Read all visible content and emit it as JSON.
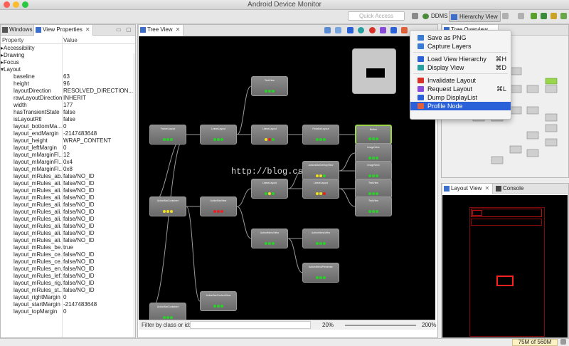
{
  "window": {
    "title": "Android Device Monitor"
  },
  "toolbar": {
    "quick_access_placeholder": "Quick Access",
    "perspectives": [
      {
        "label": "DDMS"
      },
      {
        "label": "Hierarchy View"
      }
    ]
  },
  "left_panel": {
    "tabs": [
      {
        "label": "Windows"
      },
      {
        "label": "View Properties"
      }
    ],
    "columns": {
      "property": "Property",
      "value": "Value"
    },
    "rows": [
      {
        "name": "Accessibility",
        "value": "",
        "group": true,
        "expanded": false
      },
      {
        "name": "Drawing",
        "value": "",
        "group": true,
        "expanded": false
      },
      {
        "name": "Focus",
        "value": "",
        "group": true,
        "expanded": false
      },
      {
        "name": "Layout",
        "value": "",
        "group": true,
        "expanded": true
      },
      {
        "name": "baseline",
        "value": "63"
      },
      {
        "name": "height",
        "value": "96"
      },
      {
        "name": "layoutDirection",
        "value": "RESOLVED_DIRECTION..."
      },
      {
        "name": "rawLayoutDirection",
        "value": "INHERIT"
      },
      {
        "name": "width",
        "value": "177"
      },
      {
        "name": "hasTransientState",
        "value": "false"
      },
      {
        "name": "isLayoutRtl",
        "value": "false"
      },
      {
        "name": "layout_bottomMa...",
        "value": "0"
      },
      {
        "name": "layout_endMargin",
        "value": "-2147483648"
      },
      {
        "name": "layout_height",
        "value": "WRAP_CONTENT"
      },
      {
        "name": "layout_leftMargin",
        "value": "0"
      },
      {
        "name": "layout_mMarginFl...",
        "value": "12"
      },
      {
        "name": "layout_mMarginFl...",
        "value": "0x4"
      },
      {
        "name": "layout_mMarginFl...",
        "value": "0x8"
      },
      {
        "name": "layout_mRules_ab...",
        "value": "false/NO_ID"
      },
      {
        "name": "layout_mRules_ali...",
        "value": "false/NO_ID"
      },
      {
        "name": "layout_mRules_ali...",
        "value": "false/NO_ID"
      },
      {
        "name": "layout_mRules_ali...",
        "value": "false/NO_ID"
      },
      {
        "name": "layout_mRules_ali...",
        "value": "false/NO_ID"
      },
      {
        "name": "layout_mRules_ali...",
        "value": "false/NO_ID"
      },
      {
        "name": "layout_mRules_ali...",
        "value": "false/NO_ID"
      },
      {
        "name": "layout_mRules_ali...",
        "value": "false/NO_ID"
      },
      {
        "name": "layout_mRules_ali...",
        "value": "false/NO_ID"
      },
      {
        "name": "layout_mRules_ali...",
        "value": "false/NO_ID"
      },
      {
        "name": "layout_mRules_be...",
        "value": "true"
      },
      {
        "name": "layout_mRules_ce...",
        "value": "false/NO_ID"
      },
      {
        "name": "layout_mRules_ce...",
        "value": "false/NO_ID"
      },
      {
        "name": "layout_mRules_en...",
        "value": "false/NO_ID"
      },
      {
        "name": "layout_mRules_lef...",
        "value": "false/NO_ID"
      },
      {
        "name": "layout_mRules_rig...",
        "value": "false/NO_ID"
      },
      {
        "name": "layout_mRules_st...",
        "value": "false/NO_ID"
      },
      {
        "name": "layout_rightMargin",
        "value": "0"
      },
      {
        "name": "layout_startMargin",
        "value": "-2147483648"
      },
      {
        "name": "layout_topMargin",
        "value": "0"
      }
    ]
  },
  "tree_view": {
    "tab_label": "Tree View",
    "filter_placeholder": "Filter by class or id:",
    "zoom_min": "20%",
    "zoom_max": "200%",
    "watermark": "http://blog.csdn.net/",
    "nodes": [
      {
        "title": "FrameLayout",
        "lights": [
          "green",
          "green",
          "green"
        ],
        "selected": false
      },
      {
        "title": "LinearLayout",
        "lights": [
          "green",
          "green",
          "green"
        ],
        "selected": false
      },
      {
        "title": "TextView",
        "lights": [
          "green",
          "green",
          "green"
        ],
        "selected": false
      },
      {
        "title": "LinearLayout",
        "lights": [
          "yellow",
          "red",
          "green"
        ],
        "selected": false
      },
      {
        "title": "RelativeLayout",
        "lights": [
          "green",
          "green",
          "green"
        ],
        "selected": false
      },
      {
        "title": "Button",
        "lights": [
          "green",
          "green",
          "green"
        ],
        "selected": true
      },
      {
        "title": "ActionBarContainer",
        "lights": [
          "yellow",
          "yellow",
          "yellow"
        ],
        "selected": false
      },
      {
        "title": "ActionBarView",
        "lights": [
          "red",
          "red",
          "red"
        ],
        "selected": false
      },
      {
        "title": "LinearLayout",
        "lights": [
          "green",
          "yellow",
          "green"
        ],
        "selected": false
      },
      {
        "title": "ActionBarOverlayView",
        "lights": [
          "yellow",
          "yellow",
          "green"
        ],
        "selected": false
      },
      {
        "title": "ImageView",
        "lights": [
          "green",
          "green",
          "green"
        ],
        "selected": false
      },
      {
        "title": "ImageView",
        "lights": [
          "green",
          "green",
          "green"
        ],
        "selected": false
      },
      {
        "title": "LinearLayout",
        "lights": [
          "yellow",
          "yellow",
          "red"
        ],
        "selected": false
      },
      {
        "title": "TextView",
        "lights": [
          "green",
          "green",
          "green"
        ],
        "selected": false
      },
      {
        "title": "TextView",
        "lights": [
          "green",
          "green",
          "green"
        ],
        "selected": false
      },
      {
        "title": "ActionMenuView",
        "lights": [
          "green",
          "green",
          "green"
        ],
        "selected": false
      },
      {
        "title": "ActionMenuView",
        "lights": [
          "green",
          "green",
          "green"
        ],
        "selected": false
      },
      {
        "title": "ActionMenuPresenter",
        "lights": [
          "green",
          "green",
          "green"
        ],
        "selected": false
      },
      {
        "title": "ActionBarContextView",
        "lights": [
          "green",
          "green",
          "green"
        ],
        "selected": false
      },
      {
        "title": "ActionBarContainer",
        "lights": [
          "green",
          "green",
          "green"
        ],
        "selected": false
      }
    ]
  },
  "overview_panel": {
    "tab_label": "Tree Overview"
  },
  "layout_panel": {
    "tabs": [
      {
        "label": "Layout View"
      },
      {
        "label": "Console"
      }
    ]
  },
  "context_menu": {
    "items": [
      {
        "label": "Save as PNG",
        "shortcut": "",
        "icon": "save-icon",
        "color": "#3a7bd5",
        "highlighted": false
      },
      {
        "label": "Capture Layers",
        "shortcut": "",
        "icon": "layers-icon",
        "color": "#3a7bd5",
        "highlighted": false
      },
      {
        "separator": true
      },
      {
        "label": "Load View Hierarchy",
        "shortcut": "⌘H",
        "icon": "hierarchy-icon",
        "color": "#2a61d9",
        "highlighted": false
      },
      {
        "label": "Display View",
        "shortcut": "⌘D",
        "icon": "display-icon",
        "color": "#28a0a0",
        "highlighted": false
      },
      {
        "separator": true
      },
      {
        "label": "Invalidate Layout",
        "shortcut": "",
        "icon": "invalidate-icon",
        "color": "#d9302a",
        "highlighted": false
      },
      {
        "label": "Request Layout",
        "shortcut": "⌘L",
        "icon": "request-icon",
        "color": "#8a4ad9",
        "highlighted": false
      },
      {
        "label": "Dump DisplayList",
        "shortcut": "",
        "icon": "dump-icon",
        "color": "#2a61d9",
        "highlighted": false
      },
      {
        "label": "Profile Node",
        "shortcut": "",
        "icon": "profile-icon",
        "color": "#e0603a",
        "highlighted": true
      }
    ]
  },
  "status_bar": {
    "memory": "75M of 560M"
  },
  "colors": {
    "green": "#2bd12b",
    "yellow": "#f0e020",
    "red": "#e82020",
    "highlight": "#2a61d9"
  }
}
